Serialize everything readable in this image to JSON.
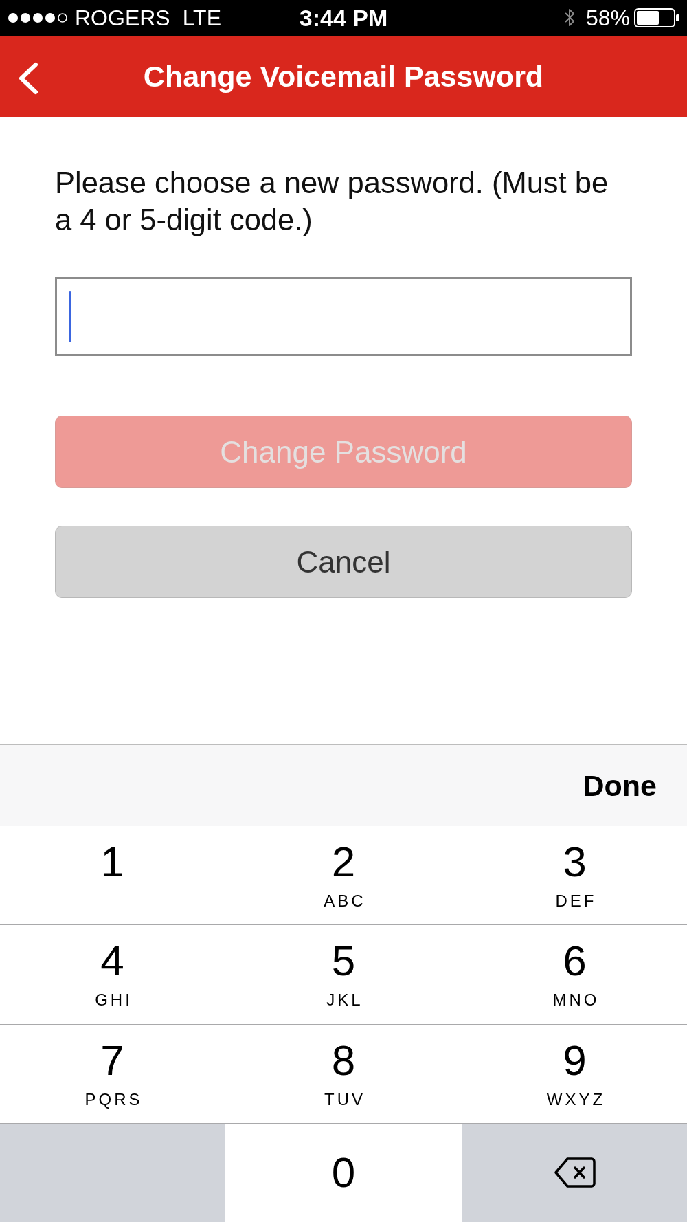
{
  "status_bar": {
    "carrier": "ROGERS",
    "network": "LTE",
    "time": "3:44 PM",
    "battery": "58%"
  },
  "nav_bar": {
    "title": "Change Voicemail Password"
  },
  "instructions": "Please choose a new password. (Must be a 4 or 5-digit code.)",
  "password_field": {
    "focused": true
  },
  "buttons": [
    {
      "label": "Change Password",
      "kind": "primary",
      "disabled": true
    },
    {
      "label": "Cancel",
      "kind": "secondary",
      "disabled": false
    }
  ],
  "keyboard": {
    "done": "Done",
    "rows": [
      [
        {
          "kind": "digit",
          "digit": "1"
        },
        {
          "kind": "digit",
          "digit": "2",
          "letters": "ABC"
        },
        {
          "kind": "digit",
          "digit": "3",
          "letters": "DEF"
        }
      ],
      [
        {
          "kind": "digit",
          "digit": "4",
          "letters": "GHI"
        },
        {
          "kind": "digit",
          "digit": "5",
          "letters": "JKL"
        },
        {
          "kind": "digit",
          "digit": "6",
          "letters": "MNO"
        }
      ],
      [
        {
          "kind": "digit",
          "digit": "7",
          "letters": "PQRS"
        },
        {
          "kind": "digit",
          "digit": "8",
          "letters": "TUV"
        },
        {
          "kind": "digit",
          "digit": "9",
          "letters": "WXYZ"
        }
      ],
      [
        {
          "kind": "blank"
        },
        {
          "kind": "digit",
          "digit": "0"
        },
        {
          "kind": "delete"
        }
      ]
    ]
  }
}
